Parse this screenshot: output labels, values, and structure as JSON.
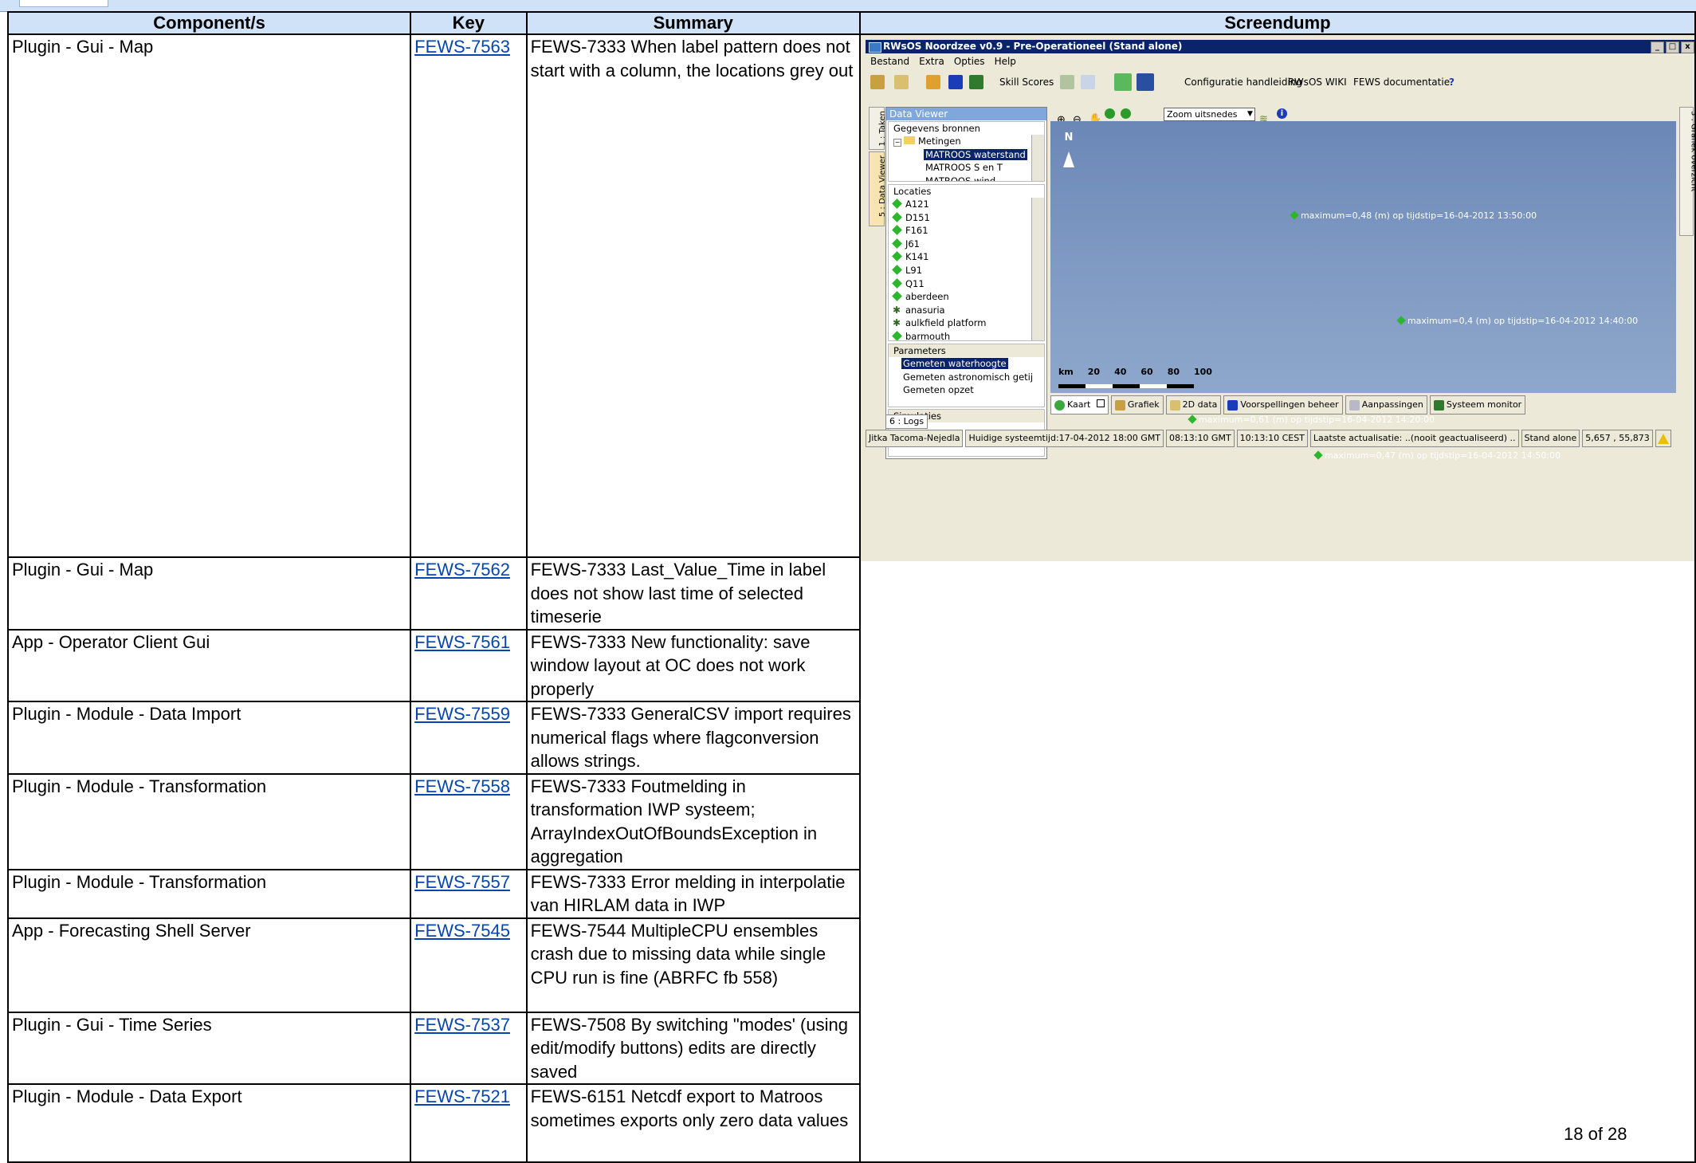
{
  "columns": [
    "Component/s",
    "Key",
    "Summary",
    "Screendump"
  ],
  "rows": [
    {
      "component": "Plugin - Gui - Map",
      "key": "FEWS-7563",
      "summary": "FEWS-7333 When label pattern does not start with a column, the locations grey out"
    },
    {
      "component": "Plugin - Gui - Map",
      "key": "FEWS-7562",
      "summary": "FEWS-7333 Last_Value_Time in label does not show last time of selected timeserie"
    },
    {
      "component": "App - Operator Client Gui",
      "key": "FEWS-7561",
      "summary": "FEWS-7333 New functionality: save window layout at OC does not work properly"
    },
    {
      "component": "Plugin - Module - Data Import",
      "key": "FEWS-7559",
      "summary": "FEWS-7333 GeneralCSV import requires numerical flags where flagconversion allows strings."
    },
    {
      "component": "Plugin - Module - Transformation",
      "key": "FEWS-7558",
      "summary": "FEWS-7333 Foutmelding in transformation IWP systeem; ArrayIndexOutOfBoundsException in aggregation"
    },
    {
      "component": "Plugin - Module - Transformation",
      "key": "FEWS-7557",
      "summary": "FEWS-7333 Error melding in interpolatie van HIRLAM data in IWP"
    },
    {
      "component": "App - Forecasting Shell Server",
      "key": "FEWS-7545",
      "summary": "FEWS-7544 MultipleCPU ensembles crash due to missing data while single CPU run is fine (ABRFC fb 558)"
    },
    {
      "component": "Plugin - Gui - Time Series",
      "key": "FEWS-7537",
      "summary": "FEWS-7508 By switching \"modes' (using edit/modify buttons) edits are directly saved"
    },
    {
      "component": "Plugin - Module - Data Export",
      "key": "FEWS-7521",
      "summary": "FEWS-6151 Netcdf export to Matroos sometimes exports only zero data values"
    }
  ],
  "page_number": "18 of 28",
  "screendump": {
    "title": "RWsOS Noordzee v0.9 - Pre-Operationeel  (Stand alone)",
    "window_buttons": [
      "_",
      "□",
      "x"
    ],
    "menu": [
      "Bestand",
      "Extra",
      "Opties",
      "Help"
    ],
    "toolbar": {
      "skill_scores": "Skill Scores",
      "config_manual": "Configuratie handleiding",
      "wiki": "RWsOS WIKI",
      "fews_doc": "FEWS documentatie",
      "help": "?"
    },
    "left_tabs": [
      "1 : Taken",
      "5 : Data Viewer"
    ],
    "right_tab": "3 : Grafiek overzicht",
    "data_viewer": {
      "title": "Data Viewer",
      "sources_header": "Gegevens bronnen",
      "sources_root": "Metingen",
      "sources": [
        "MATROOS waterstand",
        "MATROOS S en T",
        "MATROOS wind"
      ],
      "locations_header": "Locaties",
      "locations": [
        {
          "name": "A121",
          "status": "ok"
        },
        {
          "name": "D151",
          "status": "ok"
        },
        {
          "name": "F161",
          "status": "ok"
        },
        {
          "name": "J61",
          "status": "ok"
        },
        {
          "name": "K141",
          "status": "ok"
        },
        {
          "name": "L91",
          "status": "ok"
        },
        {
          "name": "Q11",
          "status": "ok"
        },
        {
          "name": "aberdeen",
          "status": "ok"
        },
        {
          "name": "anasuria",
          "status": "grey"
        },
        {
          "name": "aulkfield platform",
          "status": "grey"
        },
        {
          "name": "barmouth",
          "status": "ok"
        }
      ],
      "parameters_header": "Parameters",
      "parameters": [
        "Gemeten waterhoogte",
        "Gemeten astronomisch getij",
        "Gemeten opzet"
      ],
      "simulations_header": "Simulaties"
    },
    "map": {
      "zoom_select": "Zoom uitsnedes",
      "north": "N",
      "markers": [
        "maximum=0,48 (m)  op tijdstip=16-04-2012 13:50:00",
        "maximum=0,4 (m)  op tijdstip=16-04-2012 14:40:00",
        "maximum=0,61 (m)  op tijdstip=16-04-2012 14:20:00",
        "maximum=0,47 (m)  op tijdstip=16-04-2012 14:50:00"
      ],
      "scale_labels": [
        "km",
        "20",
        "40",
        "60",
        "80",
        "100"
      ]
    },
    "bottom_tabs": [
      "Kaart",
      "Grafiek",
      "2D data",
      "Voorspellingen beheer",
      "Aanpassingen",
      "Systeem monitor"
    ],
    "log_tab": "6 : Logs",
    "status": [
      "Jitka Tacoma-Nejedla",
      "Huidige systeemtijd:17-04-2012 18:00 GMT",
      "08:13:10 GMT",
      "10:13:10 CEST",
      "Laatste actualisatie: ..(nooit geactualiseerd) ..",
      "Stand alone",
      "5,657 , 55,873"
    ],
    "colors": {
      "title_bar": "#0a246a",
      "map_water": "#7a96c1",
      "ok_marker": "#2db52d",
      "panel_header": "#7fa6dd"
    }
  }
}
